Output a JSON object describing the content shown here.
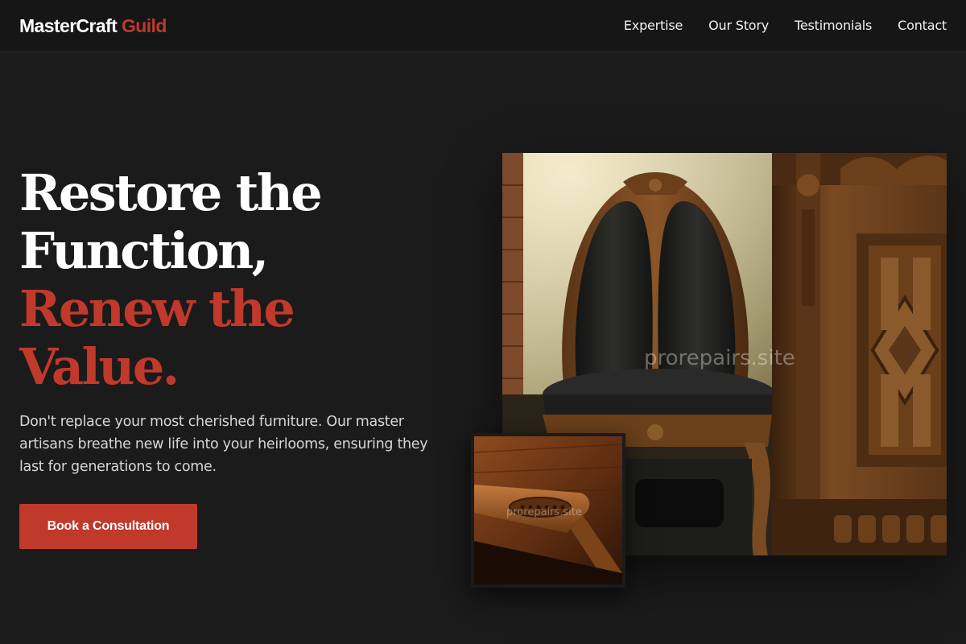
{
  "header": {
    "logo_main": "MasterCraft",
    "logo_accent": "Guild",
    "nav": [
      "Expertise",
      "Our Story",
      "Testimonials",
      "Contact"
    ]
  },
  "hero": {
    "title_lines": [
      "Restore the",
      "Function,"
    ],
    "title_accent_lines": [
      "Renew the",
      "Value."
    ],
    "description": "Don't replace your most cherished furniture. Our master artisans breathe new life into your heirlooms, ensuring they last for generations to come.",
    "cta_label": "Book a Consultation"
  },
  "images": {
    "main_alt": "Antique carved wooden chair with upholstered back beside an ornate carved cabinet",
    "inset_alt": "Close-up of a carved wooden armrest detail",
    "watermark": "prorepairs.site"
  },
  "colors": {
    "background": "#1b1b1b",
    "accent": "#c0392b",
    "text": "#ffffff"
  }
}
